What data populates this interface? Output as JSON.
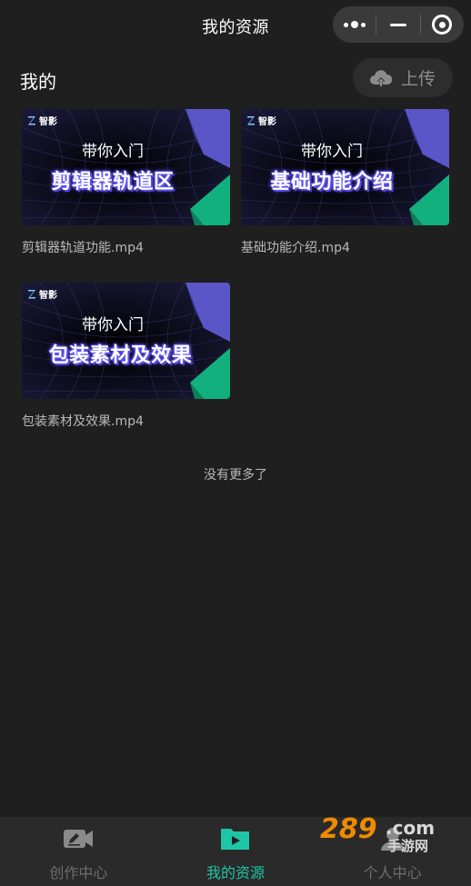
{
  "header": {
    "title": "我的资源"
  },
  "section": {
    "title": "我的",
    "upload_label": "上传"
  },
  "videos": [
    {
      "brand": "智影",
      "subtitle": "带你入门",
      "headline": "剪辑器轨道区",
      "filename": "剪辑器轨道功能.mp4"
    },
    {
      "brand": "智影",
      "subtitle": "带你入门",
      "headline": "基础功能介绍",
      "filename": "基础功能介绍.mp4"
    },
    {
      "brand": "智影",
      "subtitle": "带你入门",
      "headline": "包装素材及效果",
      "filename": "包装素材及效果.mp4"
    }
  ],
  "list_end_text": "没有更多了",
  "tabs": [
    {
      "label": "创作中心",
      "icon": "camera-edit-icon",
      "active": false
    },
    {
      "label": "我的资源",
      "icon": "folder-play-icon",
      "active": true
    },
    {
      "label": "个人中心",
      "icon": "person-icon",
      "active": false
    }
  ],
  "watermark": "289.com 手游网",
  "colors": {
    "accent": "#1fc6a5",
    "background": "#1f1f1f",
    "tabbar": "#2a2a2a"
  }
}
